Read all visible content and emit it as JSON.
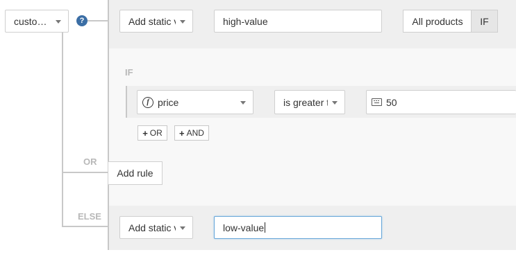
{
  "root_select": {
    "label": "custo…"
  },
  "help_icon": {
    "glyph": "?"
  },
  "top_row": {
    "value_type": "Add static v",
    "value": "high-value",
    "scope_label": "All products",
    "if_label": "IF"
  },
  "condition_group": {
    "if_label": "IF",
    "field": "price",
    "operator": "is greater t",
    "value": "50",
    "or_button": "OR",
    "and_button": "AND"
  },
  "or_section": {
    "label": "OR",
    "add_rule": "Add rule"
  },
  "else_section": {
    "label": "ELSE",
    "value_type": "Add static v",
    "value": "low-value"
  },
  "colors": {
    "accent": "#3b6ea5",
    "focus_border": "#66a6d8",
    "panel_gray": "#efefef",
    "panel_light": "#f8f8f8",
    "connector": "#c8c8c8"
  }
}
